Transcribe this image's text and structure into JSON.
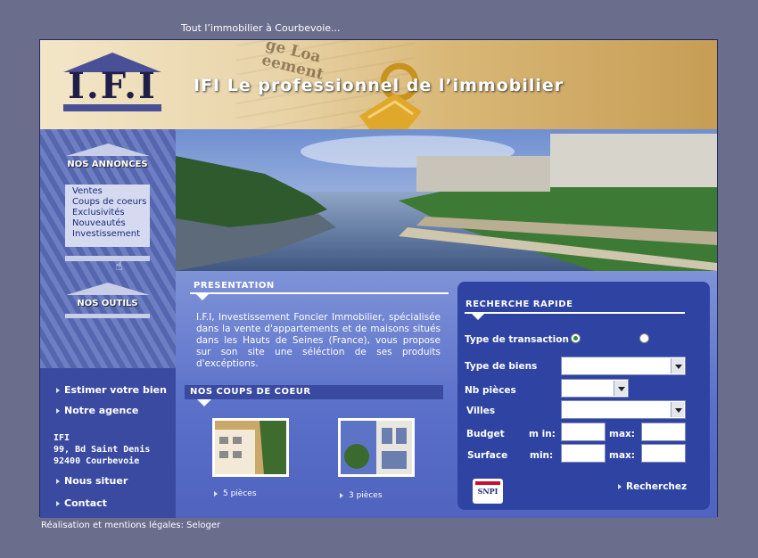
{
  "top_tagline": "Tout l’immobilier à Courbevoie...",
  "header": {
    "logo_text": "I.F.I",
    "slogan": "IFI  Le professionnel de l’immobilier",
    "background_text": [
      "ge Loa",
      "eement"
    ]
  },
  "sidebar": {
    "annonces_label": "NOS ANNONCES",
    "annonces_items": [
      "Ventes",
      "Coups de coeurs",
      "Exclusivités",
      "Nouveautés",
      "Investissement"
    ],
    "outils_label": "NOS OUTILS",
    "links": {
      "estimer": "Estimer votre bien",
      "agence": "Notre agence",
      "situer": "Nous situer",
      "contact": "Contact"
    },
    "address": {
      "line1": "IFI",
      "line2": "99, Bd Saint Denis",
      "line3": "92400 Courbevoie"
    }
  },
  "presentation": {
    "title": "PRESENTATION",
    "text": "I.F.I, Investissement Foncier Immobilier, spécialisée dans la vente d'appartements et de maisons situés dans les Hauts de Seines (France), vous propose sur son site une séléction de ses produits d'excéptions."
  },
  "coups_de_coeur": {
    "title": "NOS COUPS DE COEUR",
    "items": [
      {
        "caption": "5 pièces"
      },
      {
        "caption": "3 pièces"
      }
    ]
  },
  "search": {
    "title": "RECHERCHE RAPIDE",
    "type_transaction_label": "Type de transaction",
    "type_biens_label": "Type de biens",
    "nb_pieces_label": "Nb pièces",
    "villes_label": "Villes",
    "budget_label": "Budget",
    "surface_label": "Surface",
    "min_label_budget": "m in:",
    "max_label_budget": "max:",
    "min_label_surface": "min:",
    "max_label_surface": "max:",
    "submit_label": "Recherchez",
    "badge_text": "SNPI"
  },
  "footer": {
    "text": "Réalisation et mentions légales: Seloger"
  },
  "colors": {
    "page_bg": "#6b6d8c",
    "frame_blue": "#3a4a9a",
    "search_panel": "#2f44a2",
    "header_gold": "#d9b877"
  }
}
